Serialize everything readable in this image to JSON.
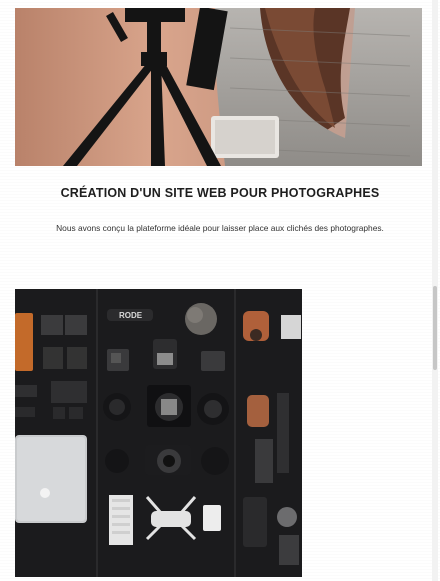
{
  "section": {
    "title": "CRÉATION D'UN SITE WEB POUR PHOTOGRAPHES",
    "description": "Nous avons conçu la plateforme idéale pour laisser place aux clichés des photographes."
  },
  "gear_photo": {
    "mic_brand": "RODE"
  },
  "colors": {
    "heading": "#1e1e1e",
    "gear_background": "#1b1b1d",
    "hero_background": "#c8a898"
  }
}
